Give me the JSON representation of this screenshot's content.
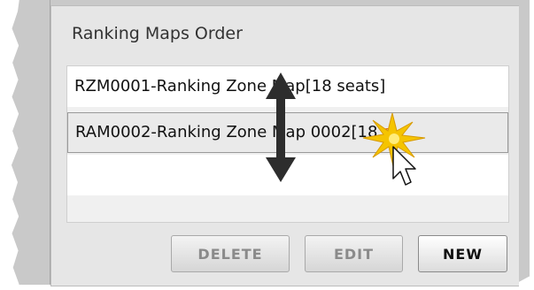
{
  "panel": {
    "title": "Ranking Maps Order"
  },
  "list": {
    "items": [
      {
        "text": "RZM0001-Ranking Zone Map[18 seats]",
        "selected": false
      },
      {
        "text_main": "RAM0002-Ranking Zone Map 0002[18 ",
        "text_tail": "s",
        "selected": true
      }
    ]
  },
  "buttons": {
    "delete": {
      "label": "DELETE",
      "enabled": false
    },
    "edit": {
      "label": "EDIT",
      "enabled": false
    },
    "new": {
      "label": "NEW",
      "enabled": true
    }
  },
  "annotations": {
    "drag_arrow_icon": "double-vertical-arrow",
    "click_icon": "starburst-click",
    "cursor_icon": "arrow-cursor"
  },
  "colors": {
    "panel_bg": "#e6e6e6",
    "text_accent": "#e06a10",
    "arrow": "#2d2d2d",
    "starburst": "#f5c400"
  }
}
